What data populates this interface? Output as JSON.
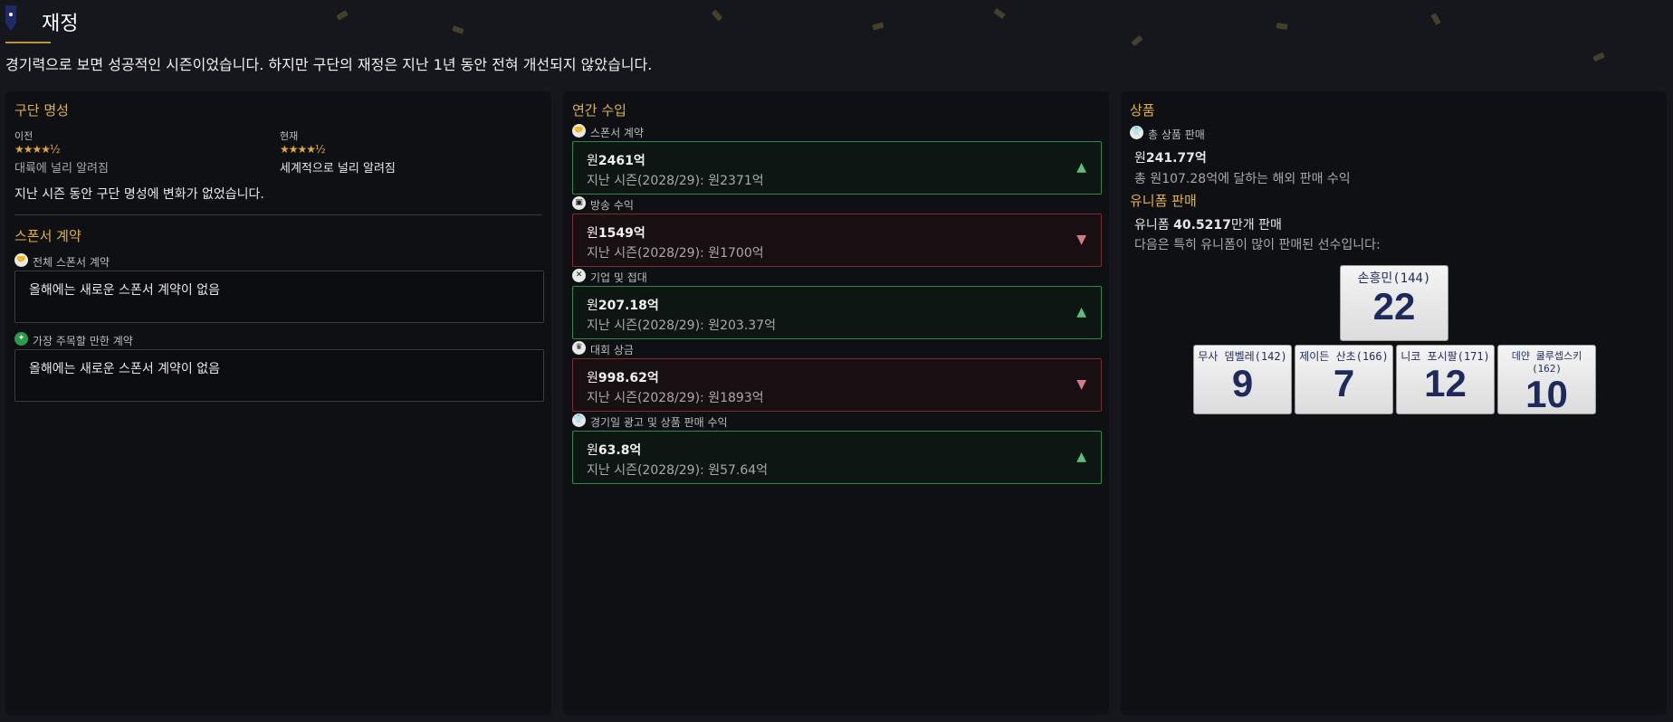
{
  "header": {
    "title": "재정",
    "subtitle": "경기력으로 보면 성공적인 시즌이었습니다. 하지만 구단의 재정은 지난 1년 동안 전혀 개선되지 않았습니다."
  },
  "reputation": {
    "title": "구단 명성",
    "previous_label": "이전",
    "previous_stars": "★★★★½",
    "previous_text": "대륙에 널리 알려짐",
    "current_label": "현재",
    "current_stars": "★★★★½",
    "current_text": "세계적으로 널리 알려짐",
    "note": "지난 시즌 동안 구단 명성에 변화가 없었습니다."
  },
  "sponsorship": {
    "title": "스폰서 계약",
    "all_label": "전체 스폰서 계약",
    "all_text": "올해에는 새로운 스폰서 계약이 없음",
    "notable_label": "가장 주목할 만한 계약",
    "notable_text": "올해에는 새로운 스폰서 계약이 없음"
  },
  "income": {
    "title": "연간 수입",
    "rows": [
      {
        "label": "스폰서 계약",
        "prefix": "원",
        "value": "2461억",
        "prev": "지난 시즌(2028/29): 원2371억",
        "trend": "up",
        "icon": "handshake-icon"
      },
      {
        "label": "방송 수익",
        "prefix": "원",
        "value": "1549억",
        "prev": "지난 시즌(2028/29): 원1700억",
        "trend": "down",
        "icon": "broadcast-icon"
      },
      {
        "label": "기업 및 접대",
        "prefix": "원",
        "value": "207.18억",
        "prev": "지난 시즌(2028/29): 원203.37억",
        "trend": "up",
        "icon": "hospitality-icon"
      },
      {
        "label": "대회 상금",
        "prefix": "원",
        "value": "998.62억",
        "prev": "지난 시즌(2028/29): 원1893억",
        "trend": "down",
        "icon": "trophy-icon"
      },
      {
        "label": "경기일 광고 및 상품 판매 수익",
        "prefix": "원",
        "value": "63.8억",
        "prev": "지난 시즌(2028/29): 원57.64억",
        "trend": "up",
        "icon": "shirt-icon"
      }
    ]
  },
  "merch": {
    "title": "상품",
    "total_label": "총 상품 판매",
    "total_prefix": "원",
    "total_value": "241.77억",
    "overseas_text": "총 원107.28억에 달하는 해외 판매 수익",
    "uniform_title": "유니폼 판매",
    "uniform_prefix": "유니폼 ",
    "uniform_value": "40.5217",
    "uniform_suffix": "만개 판매",
    "uniform_note": "다음은 특히 유니폼이 많이 판매된 선수입니다:",
    "jerseys": [
      {
        "name": "손흥민(144)",
        "number": "22"
      },
      {
        "name": "무사 뎀벨레(142)",
        "number": "9"
      },
      {
        "name": "제이든 산초(166)",
        "number": "7"
      },
      {
        "name": "니코 포시팔(171)",
        "number": "12"
      },
      {
        "name": "데얀 쿨루셉스키(162)",
        "number": "10"
      }
    ]
  }
}
